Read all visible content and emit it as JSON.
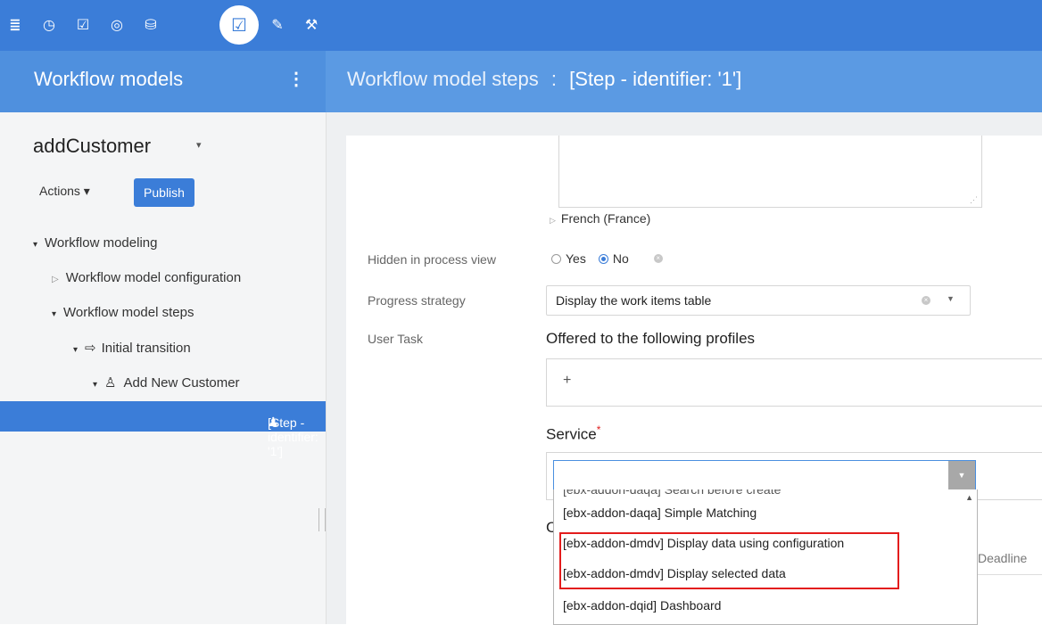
{
  "toolbar": {
    "icons": [
      {
        "name": "database-icon",
        "glyph": "≣"
      },
      {
        "name": "clock-icon",
        "glyph": "◷"
      },
      {
        "name": "checkbox-icon",
        "glyph": "☑"
      },
      {
        "name": "gauge-icon",
        "glyph": "◎"
      },
      {
        "name": "data-check-icon",
        "glyph": "⛁"
      },
      {
        "name": "workflow-edit-icon",
        "glyph": "☑",
        "active": true
      },
      {
        "name": "plug-icon",
        "glyph": "✎"
      },
      {
        "name": "wrench-icon",
        "glyph": "⚒"
      }
    ],
    "accent": "#3b7dd8"
  },
  "header": {
    "left_title": "Workflow models",
    "kebab": "⋮",
    "right_prefix": "Workflow model steps",
    "right_sep": ":",
    "right_current": "[Step - identifier: '1']"
  },
  "sidebar": {
    "model_name": "addCustomer",
    "model_caret": "▾",
    "actions_label": "Actions ▾",
    "publish_label": "Publish",
    "tree": [
      {
        "label": "Workflow modeling",
        "toggle": "▾"
      },
      {
        "label": "Workflow model configuration",
        "toggle": "▷"
      },
      {
        "label": "Workflow model steps",
        "toggle": "▾"
      },
      {
        "label": "Initial transition",
        "toggle": "▾",
        "icon": "transition-icon",
        "glyph": "⇨"
      },
      {
        "label": "Add New Customer",
        "toggle": "▾",
        "icon": "user-task-icon",
        "glyph": "♙"
      },
      {
        "label": "[Step - identifier: '1']",
        "icon": "step-icon",
        "glyph": "♟",
        "selected": true
      }
    ]
  },
  "form": {
    "language_label": "French (France)",
    "hidden_label": "Hidden in process view",
    "hidden_yes": "Yes",
    "hidden_no": "No",
    "hidden_value": "No",
    "progress_label": "Progress strategy",
    "progress_value": "Display the work items table",
    "user_task_label": "User Task",
    "profiles_title": "Offered to the following profiles",
    "profiles_add": "+",
    "service_title": "Service",
    "service_required": "*",
    "service_options": [
      "[ebx-addon-daqa] Search before create",
      "[ebx-addon-daqa] Simple Matching",
      "[ebx-addon-dmdv] Display data using configuration",
      "[ebx-addon-dmdv] Display selected data",
      "[ebx-addon-dqid] Dashboard"
    ],
    "partial_section": "C",
    "deadline_label": "Deadline"
  }
}
